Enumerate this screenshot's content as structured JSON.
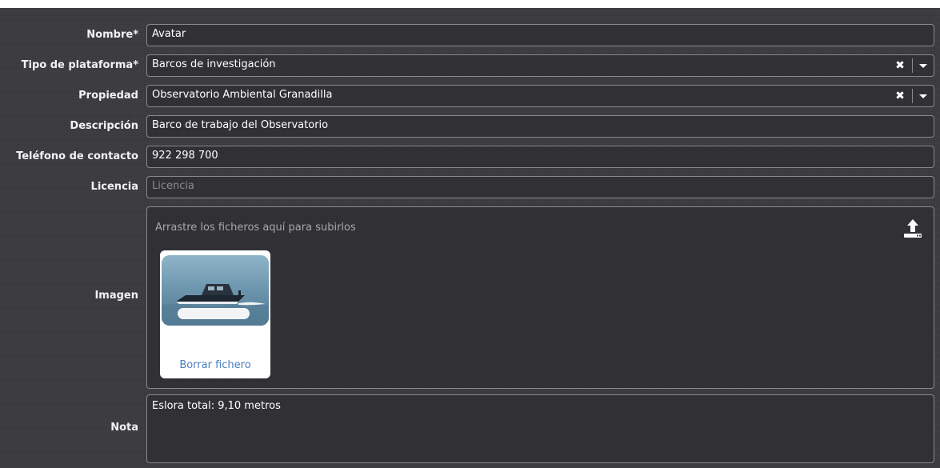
{
  "form": {
    "nombre": {
      "label": "Nombre*",
      "value": "Avatar"
    },
    "tipo": {
      "label": "Tipo de plataforma*",
      "value": "Barcos de investigación",
      "clear": "✖"
    },
    "propiedad": {
      "label": "Propiedad",
      "value": "Observatorio Ambiental Granadilla",
      "clear": "✖"
    },
    "descripcion": {
      "label": "Descripción",
      "value": "Barco de trabajo del Observatorio"
    },
    "telefono": {
      "label": "Teléfono de contacto",
      "value": "922 298 700"
    },
    "licencia": {
      "label": "Licencia",
      "placeholder": "Licencia",
      "value": ""
    },
    "imagen": {
      "label": "Imagen",
      "dropzone_text": "Arrastre los ficheros aquí para subirlos",
      "delete_label": "Borrar fichero",
      "upload_icon": "upload-icon"
    },
    "nota": {
      "label": "Nota",
      "value": "Eslora total: 9,10 metros"
    }
  },
  "colors": {
    "background": "#3c3c40",
    "border": "#8a8a8e",
    "link": "#4a7fbf"
  }
}
